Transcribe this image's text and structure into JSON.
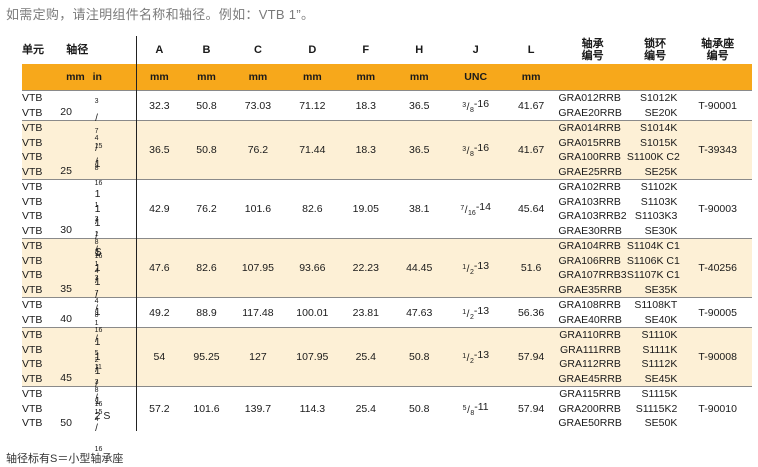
{
  "intro": "如需定购，请注明组件名称和轴径。例如：VTB 1”。",
  "footnote": "轴径标有S＝小型轴承座",
  "headers": {
    "unit": "单元",
    "shaft": "轴径",
    "A": "A",
    "B": "B",
    "C": "C",
    "D": "D",
    "F": "F",
    "H": "H",
    "J": "J",
    "L": "L",
    "bearing": [
      "轴承",
      "编号"
    ],
    "ring": [
      "锁环",
      "编号"
    ],
    "housing": [
      "轴承座",
      "编号"
    ]
  },
  "units": {
    "mm": "mm",
    "in": "in",
    "A": "mm",
    "B": "mm",
    "C": "mm",
    "D": "mm",
    "F": "mm",
    "H": "mm",
    "J": "UNC",
    "L": "mm"
  },
  "rows": [
    {
      "units": [
        "VTB",
        "VTB"
      ],
      "mm": "20",
      "inch": [
        {
          "w": "",
          "n": "3",
          "d": "4",
          "s": ""
        }
      ],
      "A": "32.3",
      "B": "50.8",
      "C": "73.03",
      "D": "71.12",
      "F": "18.3",
      "H": "36.5",
      "J": {
        "n": "3",
        "d": "8",
        "t": "-16"
      },
      "L": "41.67",
      "bearings": [
        "GRA012RRB",
        "GRAE20RRB"
      ],
      "rings": [
        "S1012K",
        "SE20K"
      ],
      "housing": "T-90001"
    },
    {
      "units": [
        "VTB",
        "VTB",
        "VTB",
        "VTB"
      ],
      "mm": "25",
      "inch": [
        {
          "w": "",
          "n": "7",
          "d": "8",
          "s": ""
        },
        {
          "w": "",
          "n": "15",
          "d": "16",
          "s": ""
        },
        {
          "w": "1",
          "n": "",
          "d": "",
          "s": ""
        }
      ],
      "A": "36.5",
      "B": "50.8",
      "C": "76.2",
      "D": "71.44",
      "F": "18.3",
      "H": "36.5",
      "J": {
        "n": "3",
        "d": "8",
        "t": "-16"
      },
      "L": "41.67",
      "bearings": [
        "GRA014RRB",
        "GRA015RRB",
        "GRA100RRB",
        "GRAE25RRB"
      ],
      "rings": [
        "S1014K",
        "S1015K",
        "S1100K C2",
        "SE25K"
      ],
      "housing": "T-39343"
    },
    {
      "units": [
        "VTB",
        "VTB",
        "VTB",
        "VTB"
      ],
      "mm": "30",
      "inch": [
        {
          "w": "1",
          "n": "1",
          "d": "8",
          "s": ""
        },
        {
          "w": "1",
          "n": "3",
          "d": "16",
          "s": ""
        },
        {
          "w": "1",
          "n": "1",
          "d": "4",
          "s": " S"
        }
      ],
      "A": "42.9",
      "B": "76.2",
      "C": "101.6",
      "D": "82.6",
      "F": "19.05",
      "H": "38.1",
      "J": {
        "n": "7",
        "d": "16",
        "t": "-14"
      },
      "L": "45.64",
      "bearings": [
        "GRA102RRB",
        "GRA103RRB",
        "GRA103RRB2",
        "GRAE30RRB"
      ],
      "rings": [
        "S1102K",
        "S1103K",
        "S1103K3",
        "SE30K"
      ],
      "housing": "T-90003"
    },
    {
      "units": [
        "VTB",
        "VTB",
        "VTB",
        "VTB"
      ],
      "mm": "35",
      "inch": [
        {
          "w": "1",
          "n": "1",
          "d": "4",
          "s": ""
        },
        {
          "w": "1",
          "n": "3",
          "d": "8",
          "s": ""
        },
        {
          "w": "1",
          "n": "7",
          "d": "16",
          "s": ""
        }
      ],
      "A": "47.6",
      "B": "82.6",
      "C": "107.95",
      "D": "93.66",
      "F": "22.23",
      "H": "44.45",
      "J": {
        "n": "1",
        "d": "2",
        "t": "-13"
      },
      "L": "51.6",
      "bearings": [
        "GRA104RRB",
        "GRA106RRB",
        "GRA107RRB3",
        "GRAE35RRB"
      ],
      "rings": [
        "S1104K C1",
        "S1106K C1",
        "S1107K C1",
        "SE35K"
      ],
      "housing": "T-40256"
    },
    {
      "units": [
        "VTB",
        "VTB"
      ],
      "mm": "40",
      "inch": [
        {
          "w": "1",
          "n": "1",
          "d": "2",
          "s": ""
        }
      ],
      "A": "49.2",
      "B": "88.9",
      "C": "117.48",
      "D": "100.01",
      "F": "23.81",
      "H": "47.63",
      "J": {
        "n": "1",
        "d": "2",
        "t": "-13"
      },
      "L": "56.36",
      "bearings": [
        "GRA108RRB",
        "GRAE40RRB"
      ],
      "rings": [
        "S1108KT",
        "SE40K"
      ],
      "housing": "T-90005"
    },
    {
      "units": [
        "VTB",
        "VTB",
        "VTB",
        "VTB"
      ],
      "mm": "45",
      "inch": [
        {
          "w": "1",
          "n": "5",
          "d": "8",
          "s": ""
        },
        {
          "w": "1",
          "n": "11",
          "d": "16",
          "s": ""
        },
        {
          "w": "1",
          "n": "3",
          "d": "4",
          "s": ""
        }
      ],
      "A": "54",
      "B": "95.25",
      "C": "127",
      "D": "107.95",
      "F": "25.4",
      "H": "50.8",
      "J": {
        "n": "1",
        "d": "2",
        "t": "-13"
      },
      "L": "57.94",
      "bearings": [
        "GRA110RRB",
        "GRA111RRB",
        "GRA112RRB",
        "GRAE45RRB"
      ],
      "rings": [
        "S1110K",
        "S1111K",
        "S1112K",
        "SE45K"
      ],
      "housing": "T-90008"
    },
    {
      "units": [
        "VTB",
        "VTB",
        "VTB"
      ],
      "mm": "50",
      "inch": [
        {
          "w": "1",
          "n": "15",
          "d": "16",
          "s": ""
        },
        {
          "w": "2 S",
          "n": "",
          "d": "",
          "s": ""
        }
      ],
      "A": "57.2",
      "B": "101.6",
      "C": "139.7",
      "D": "114.3",
      "F": "25.4",
      "H": "50.8",
      "J": {
        "n": "5",
        "d": "8",
        "t": "-11"
      },
      "L": "57.94",
      "bearings": [
        "GRA115RRB",
        "GRA200RRB",
        "GRAE50RRB"
      ],
      "rings": [
        "S1115K",
        "S1115K2",
        "SE50K"
      ],
      "housing": "T-90010"
    }
  ]
}
